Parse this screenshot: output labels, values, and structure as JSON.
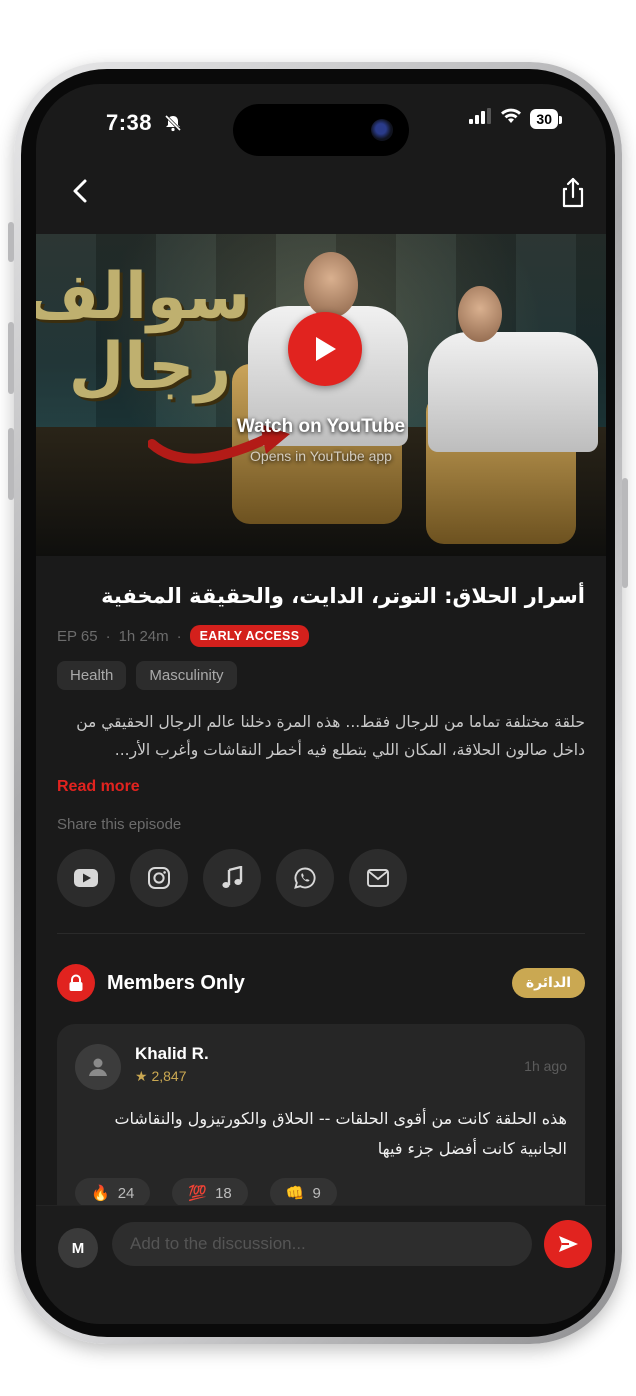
{
  "status_bar": {
    "time": "7:38",
    "battery": "30"
  },
  "video": {
    "title_art": "سوالف رجال",
    "watch_label": "Watch on YouTube",
    "opens_label": "Opens in YouTube app"
  },
  "episode": {
    "title": "أسرار الحلاق: التوتر، الدايت، والحقيقة المخفية",
    "number": "EP 65",
    "duration": "1h 24m",
    "access_badge": "EARLY ACCESS",
    "tags": [
      "Health",
      "Masculinity"
    ],
    "description": "حلقة مختلفة تماما من للرجال فقط... هذه المرة دخلنا عالم الرجال الحقيقي من داخل صالون الحلاقة، المكان اللي بتطلع فيه أخطر النقاشات وأغرب الأر...",
    "read_more": "Read more"
  },
  "share": {
    "label": "Share this episode",
    "targets": [
      "youtube",
      "instagram",
      "music",
      "whatsapp",
      "email"
    ]
  },
  "members": {
    "title": "Members Only",
    "circle_badge": "الدائرة"
  },
  "comment": {
    "author": "Khalid R.",
    "points": "★ 2,847",
    "time": "1h ago",
    "text": "هذه الحلقة كانت من أقوى الحلقات -- الحلاق والكورتيزول والنقاشات الجانبية كانت أفضل جزء فيها",
    "reactions": [
      {
        "emoji": "🔥",
        "count": "24"
      },
      {
        "emoji": "💯",
        "count": "18"
      },
      {
        "emoji": "👊",
        "count": "9"
      }
    ]
  },
  "composer": {
    "avatar_initial": "M",
    "placeholder": "Add to the discussion..."
  },
  "colors": {
    "accent": "#e1231f",
    "gold": "#caa852",
    "background": "#1a1a1a"
  }
}
